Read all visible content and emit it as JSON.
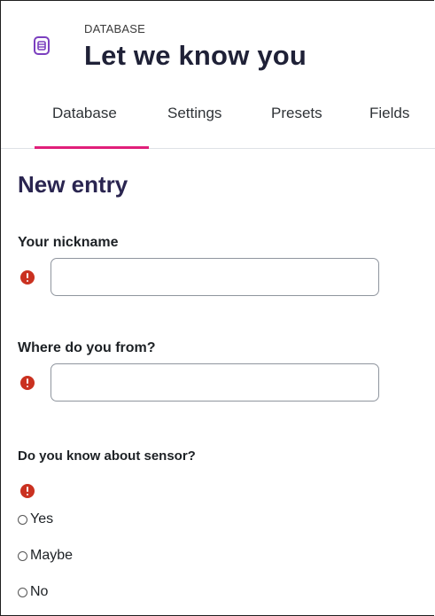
{
  "header": {
    "overline": "DATABASE",
    "title": "Let we know you",
    "icon": "database-icon",
    "icon_color": "#7b3fbf"
  },
  "tabs": [
    {
      "label": "Database",
      "active": true
    },
    {
      "label": "Settings",
      "active": false
    },
    {
      "label": "Presets",
      "active": false
    },
    {
      "label": "Fields",
      "active": false
    }
  ],
  "accent_color": "#e01f7a",
  "error_color": "#ca3120",
  "form": {
    "heading": "New entry",
    "fields": [
      {
        "label": "Your nickname",
        "value": "",
        "required": true
      },
      {
        "label": "Where do you from?",
        "value": "",
        "required": true
      }
    ],
    "radio_question": {
      "label": "Do you know about sensor?",
      "required": true,
      "options": [
        "Yes",
        "Maybe",
        "No"
      ],
      "selected": null
    }
  }
}
